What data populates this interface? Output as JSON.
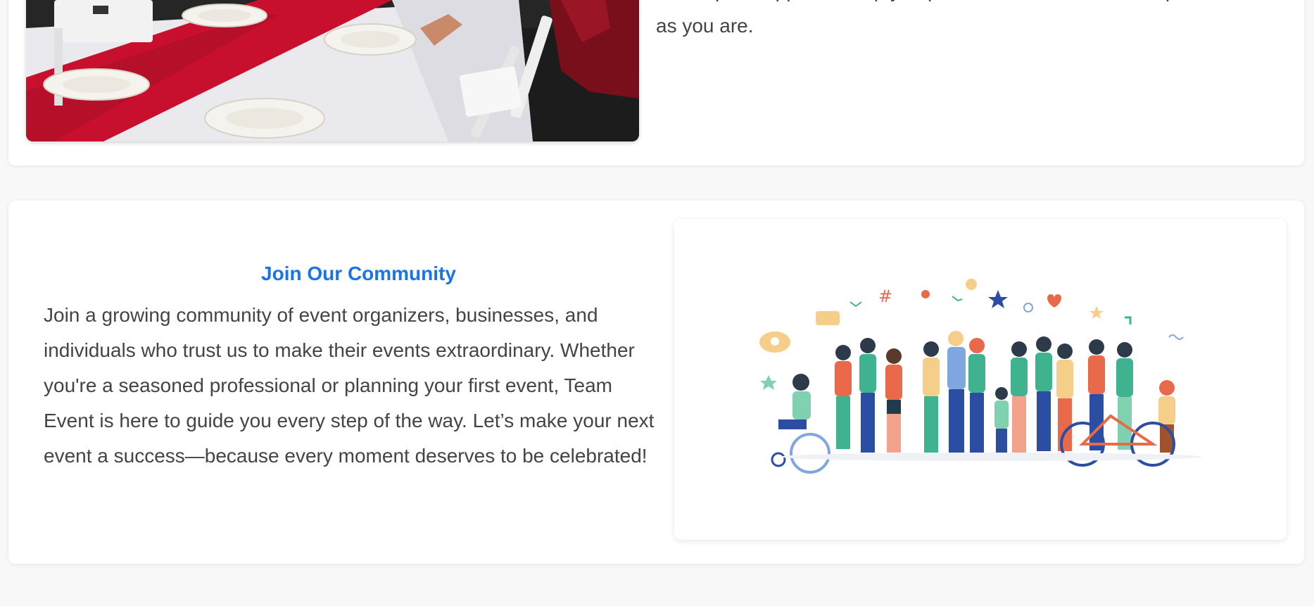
{
  "about": {
    "text_partial_top": "and expert support to help you plan events that are as unique",
    "text_partial_bottom": "as you are."
  },
  "community": {
    "heading": "Join Our Community",
    "body": "Join a growing community of event organizers, businesses, and individuals who trust us to make their events extraordinary. Whether you're a seasoned professional or planning your first event, Team Event is here to guide you every step of the way. Let’s make your next event a success—because every moment deserves to be celebrated!"
  },
  "colors": {
    "heading": "#1a73e8",
    "body_text": "#444444",
    "page_bg": "#f8f8f8",
    "card_bg": "#ffffff",
    "table_runner": "#c8102e"
  },
  "images": {
    "photo_icon": "table-setting-photo",
    "illustration_icon": "community-people-illustration"
  }
}
